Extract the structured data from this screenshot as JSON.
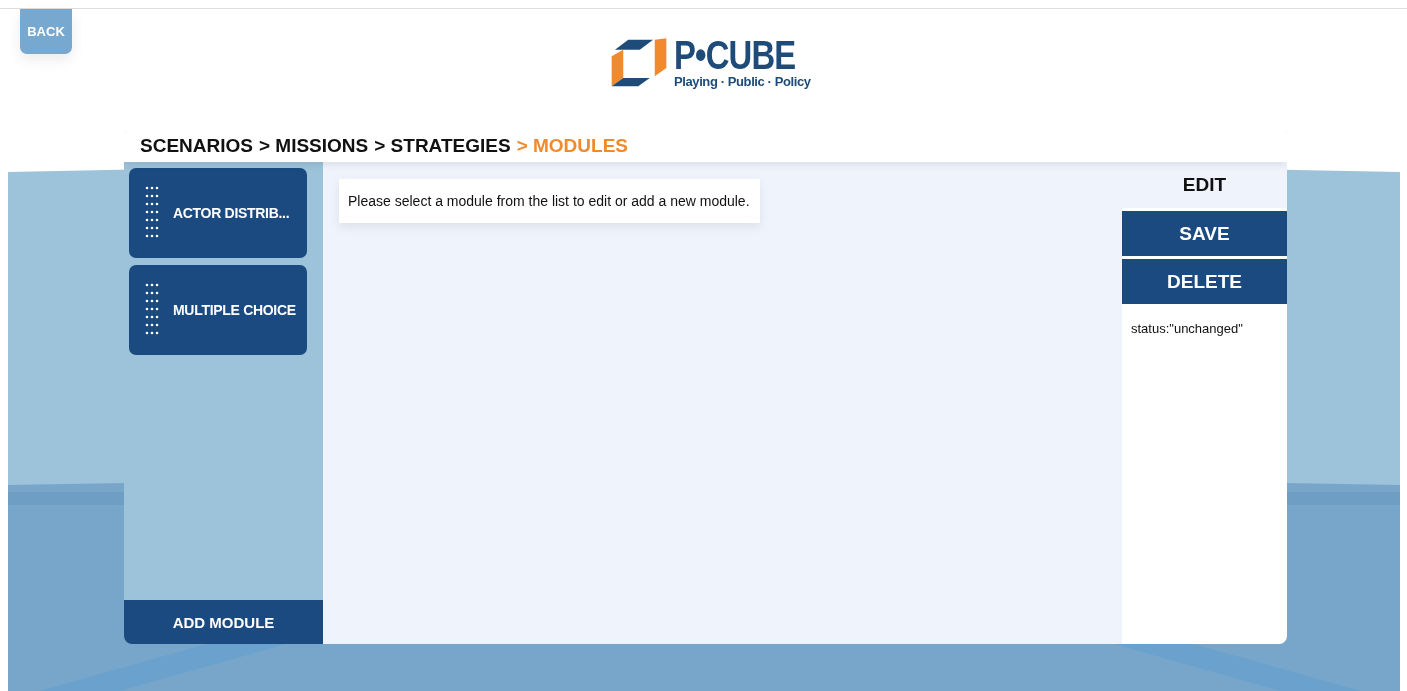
{
  "back_button": {
    "label": "BACK"
  },
  "logo": {
    "title": "P•CUBE",
    "tagline": "Playing · Public · Policy"
  },
  "breadcrumb": [
    {
      "label": "SCENARIOS",
      "current": false
    },
    {
      "label": "> MISSIONS",
      "current": false
    },
    {
      "label": "> STRATEGIES",
      "current": false
    },
    {
      "label": "> MODULES",
      "current": true
    }
  ],
  "modules": [
    {
      "label": "ACTOR DISTRIB..."
    },
    {
      "label": "MULTIPLE CHOICE"
    }
  ],
  "add_module_button": {
    "label": "ADD MODULE"
  },
  "message": "Please select a module from the list to edit or add a new module.",
  "side_panel": {
    "title": "EDIT",
    "buttons": [
      {
        "label": "SAVE"
      },
      {
        "label": "DELETE"
      }
    ],
    "status": "status:\"unchanged\""
  }
}
